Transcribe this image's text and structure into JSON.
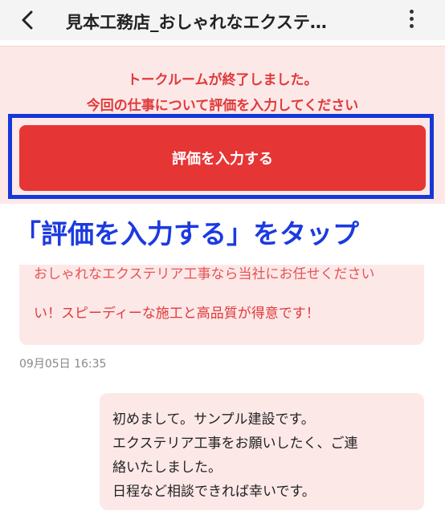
{
  "header": {
    "title": "見本工務店_おしゃれなエクステ…"
  },
  "notice": {
    "line1": "トークルームが終了しました。",
    "line2": "今回の仕事について評価を入力してください",
    "button_label": "評価を入力する"
  },
  "caption": "「評価を入力する」をタップ",
  "chat": {
    "partial_message_cut": "おしゃれなエクステリア工事なら当社にお任せください",
    "partial_message_line2": "い！スピーディーな施工と高品質が得意です！",
    "timestamp": "09月05日 16:35",
    "my_message": [
      "初めまして。サンプル建設です。",
      "エクステリア工事をお願いしたく、ご連",
      "絡いたしました。",
      "日程など相談できれば幸いです。"
    ]
  },
  "colors": {
    "accent_red": "#e63535",
    "notice_bg": "#fde8e8",
    "highlight_blue": "#1438d8"
  },
  "icons": {
    "back": "chevron-left-icon",
    "more": "vertical-ellipsis-icon"
  }
}
